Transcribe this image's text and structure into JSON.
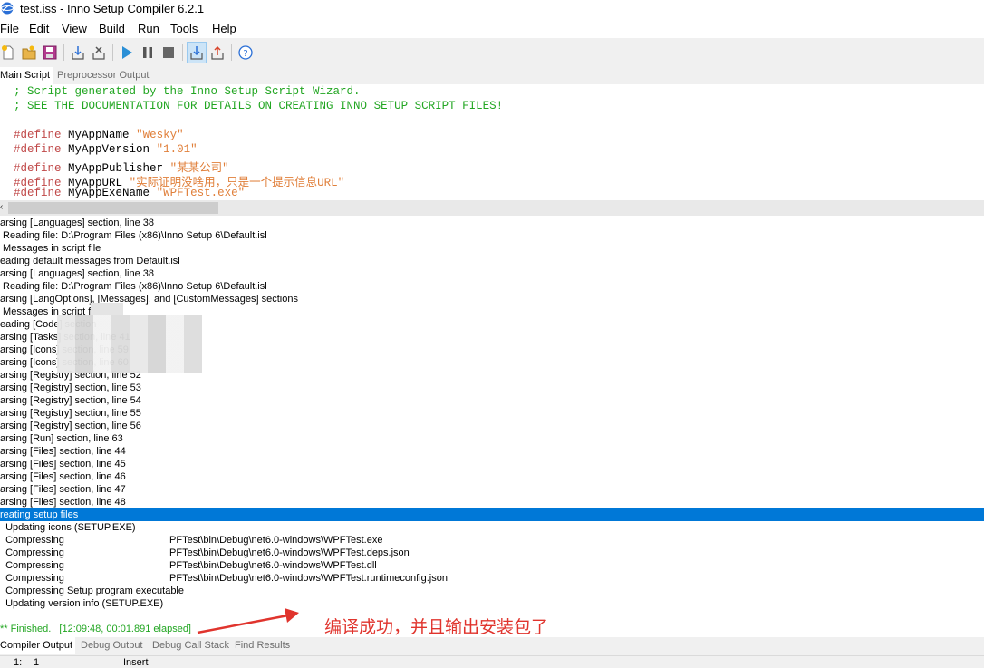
{
  "window": {
    "title": "test.iss - Inno Setup Compiler 6.2.1",
    "icon": "inno-setup-globe-icon"
  },
  "menu": {
    "items": [
      "File",
      "Edit",
      "View",
      "Build",
      "Run",
      "Tools",
      "Help"
    ]
  },
  "toolbar": {
    "buttons": [
      "new-icon",
      "open-icon",
      "save-icon",
      "compile-icon",
      "stop-compile-icon",
      "run-icon",
      "pause-icon",
      "terminate-icon",
      "target-setup-icon",
      "target-uninstall-icon",
      "help-icon"
    ]
  },
  "tabs_top": {
    "main_script": "Main Script",
    "preprocessor_output": "Preprocessor Output"
  },
  "editor": {
    "comments": [
      "; Script generated by the Inno Setup Script Wizard.",
      "; SEE THE DOCUMENTATION FOR DETAILS ON CREATING INNO SETUP SCRIPT FILES!"
    ],
    "defines": [
      {
        "kw": "#define",
        "name": "MyAppName",
        "value": "\"Wesky\""
      },
      {
        "kw": "#define",
        "name": "MyAppVersion",
        "value": "\"1.01\""
      },
      {
        "kw": "#define",
        "name": "MyAppPublisher",
        "value": "\"某某公司\""
      },
      {
        "kw": "#define",
        "name": "MyAppURL",
        "value": "\"实际证明没啥用，只是一个提示信息URL\""
      },
      {
        "kw": "#define",
        "name": "MyAppExeName",
        "value": "\"WPFTest.exe\""
      }
    ]
  },
  "output": {
    "lines": [
      "arsing [Languages] section, line 38",
      " Reading file: D:\\Program Files (x86)\\Inno Setup 6\\Default.isl",
      " Messages in script file",
      "eading default messages from Default.isl",
      "arsing [Languages] section, line 38",
      " Reading file: D:\\Program Files (x86)\\Inno Setup 6\\Default.isl",
      "arsing [LangOptions], [Messages], and [CustomMessages] sections",
      " Messages in script file",
      "eading [Code] section",
      "arsing [Tasks] section, line 41",
      "arsing [Icons] section, line 59",
      "arsing [Icons] section, line 60",
      "arsing [Registry] section, line 52",
      "arsing [Registry] section, line 53",
      "arsing [Registry] section, line 54",
      "arsing [Registry] section, line 55",
      "arsing [Registry] section, line 56",
      "arsing [Run] section, line 63",
      "arsing [Files] section, line 44",
      "arsing [Files] section, line 45",
      "arsing [Files] section, line 46",
      "arsing [Files] section, line 47",
      "arsing [Files] section, line 48",
      "reating setup files",
      "  Updating icons (SETUP.EXE)",
      "  Compressing                                      PFTest\\bin\\Debug\\net6.0-windows\\WPFTest.exe",
      "  Compressing                                      PFTest\\bin\\Debug\\net6.0-windows\\WPFTest.deps.json",
      "  Compressing                                      PFTest\\bin\\Debug\\net6.0-windows\\WPFTest.dll",
      "  Compressing                                      PFTest\\bin\\Debug\\net6.0-windows\\WPFTest.runtimeconfig.json",
      "  Compressing Setup program executable",
      "  Updating version info (SETUP.EXE)",
      "",
      "** Finished.   [12:09:48, 00:01.891 elapsed]"
    ],
    "selected_index": 23,
    "finished_index": 32
  },
  "annotation": {
    "text": "编译成功，并且输出安装包了",
    "color": "#e0342d"
  },
  "tabs_bottom": [
    "Compiler Output",
    "Debug Output",
    "Debug Call Stack",
    "Find Results"
  ],
  "status": {
    "line": "1:",
    "col": "1",
    "mode": "Insert"
  }
}
